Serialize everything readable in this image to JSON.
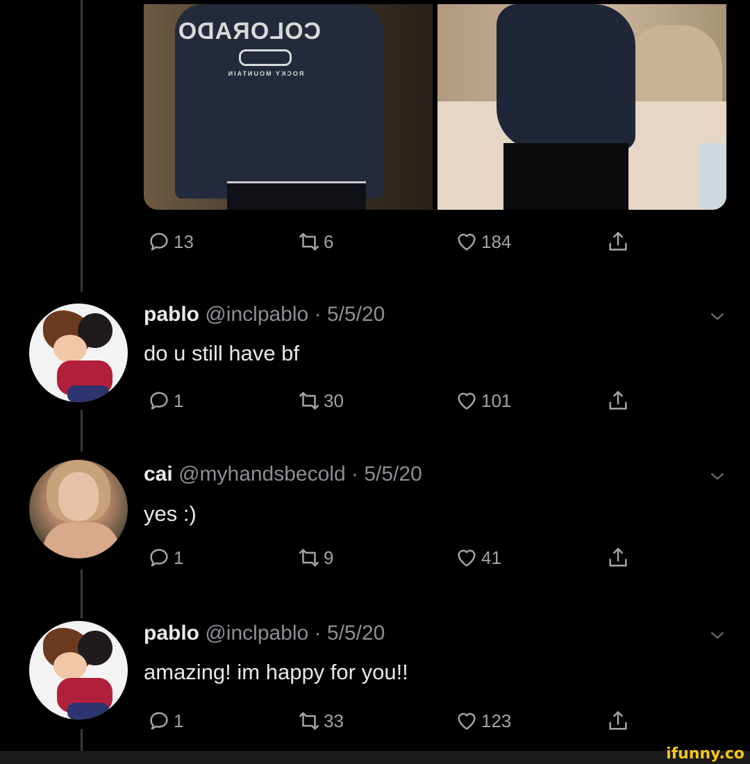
{
  "original_tweet": {
    "stats": {
      "replies": "13",
      "retweets": "6",
      "likes": "184"
    },
    "media": {
      "sweater_print": "COLORADO",
      "sweater_sub": "ROCKY MOUNTAIN"
    }
  },
  "replies": [
    {
      "name": "pablo",
      "handle": "@inclpablo",
      "date": "5/5/20",
      "text": "do u still have bf",
      "stats": {
        "replies": "1",
        "retweets": "30",
        "likes": "101"
      }
    },
    {
      "name": "cai",
      "handle": "@myhandsbecold",
      "date": "5/5/20",
      "text": "yes :)",
      "stats": {
        "replies": "1",
        "retweets": "9",
        "likes": "41"
      }
    },
    {
      "name": "pablo",
      "handle": "@inclpablo",
      "date": "5/5/20",
      "text": "amazing! im happy for you!!",
      "stats": {
        "replies": "1",
        "retweets": "33",
        "likes": "123"
      }
    }
  ],
  "separator": "·",
  "icons": {
    "reply": "reply-icon",
    "retweet": "retweet-icon",
    "like": "heart-icon",
    "share": "share-icon",
    "more": "chevron-down-icon"
  },
  "watermark": "ifunny.co",
  "colors": {
    "background": "#000000",
    "text": "#e7e9ea",
    "muted": "#8b9095",
    "icon": "#a0a4a8",
    "watermark": "#f5c518"
  }
}
